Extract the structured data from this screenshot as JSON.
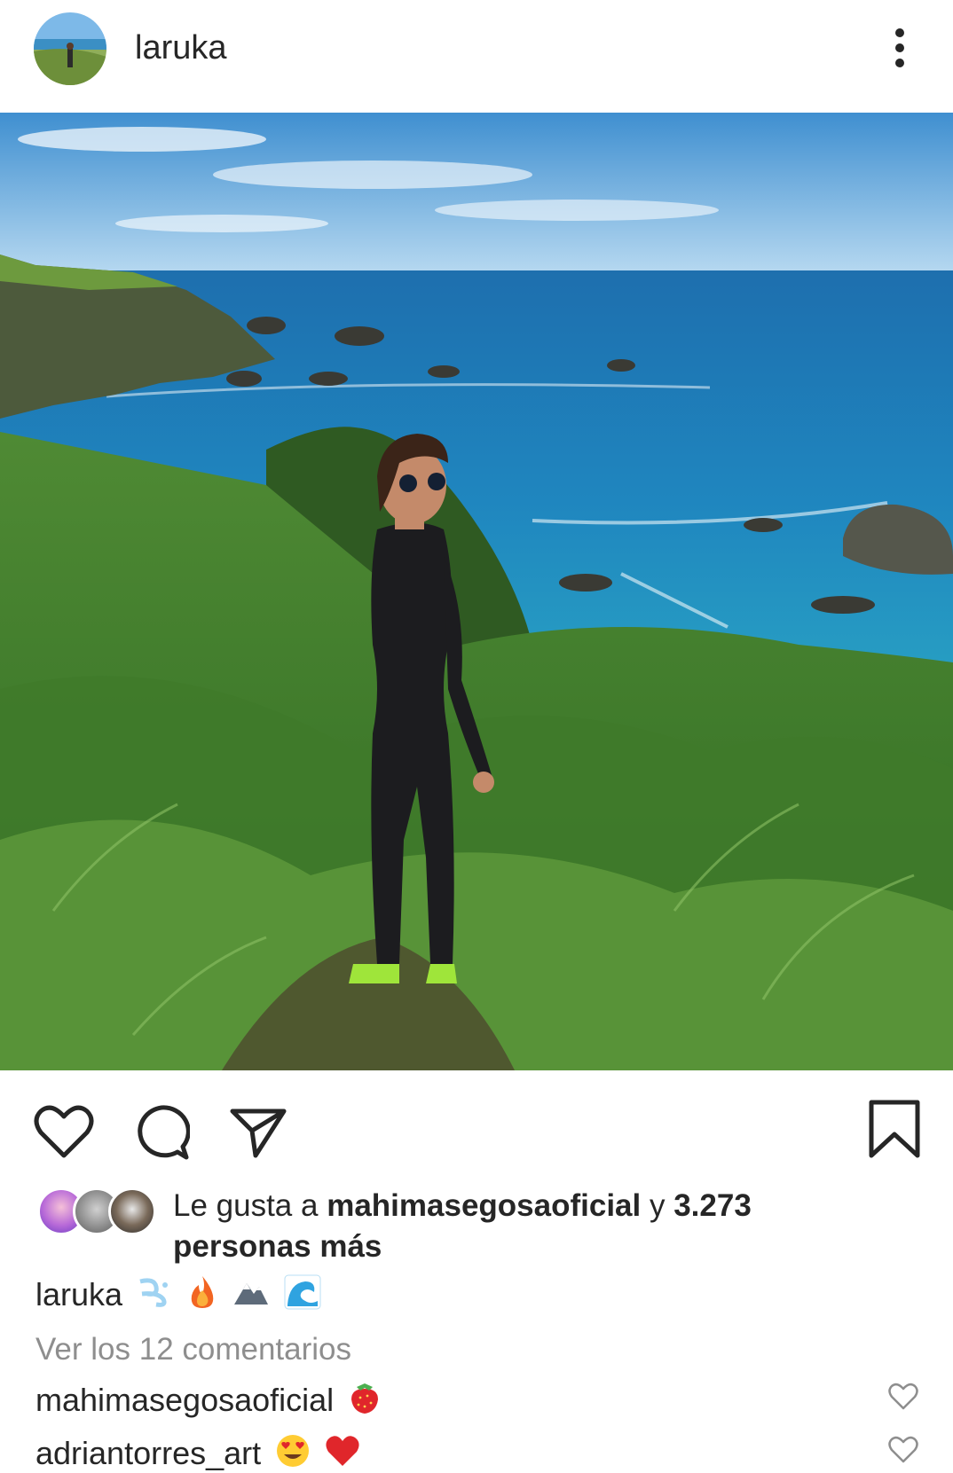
{
  "post": {
    "username": "laruka",
    "menu_icon": "more-vertical-icon"
  },
  "actions": {
    "like_icon": "heart-icon",
    "comment_icon": "comment-icon",
    "share_icon": "send-icon",
    "save_icon": "bookmark-icon"
  },
  "likes": {
    "prefix": "Le gusta a ",
    "first_user": "mahimasegosaoficial",
    "connector": " y ",
    "others": "3.273",
    "line2": "personas más"
  },
  "caption": {
    "username": "laruka",
    "emojis": [
      "dash-emoji",
      "fire-emoji",
      "mountain-emoji",
      "wave-emoji"
    ]
  },
  "view_comments": "Ver los 12 comentarios",
  "comments": [
    {
      "username": "mahimasegosaoficial",
      "emojis": [
        "strawberry-emoji"
      ]
    },
    {
      "username": "adriantorres_art",
      "emojis": [
        "heart-eyes-emoji",
        "red-heart-emoji"
      ]
    }
  ],
  "colors": {
    "text": "#262626",
    "muted": "#8e8e8e",
    "sea": "#1f7fb3",
    "sky": "#5aa4d8"
  }
}
